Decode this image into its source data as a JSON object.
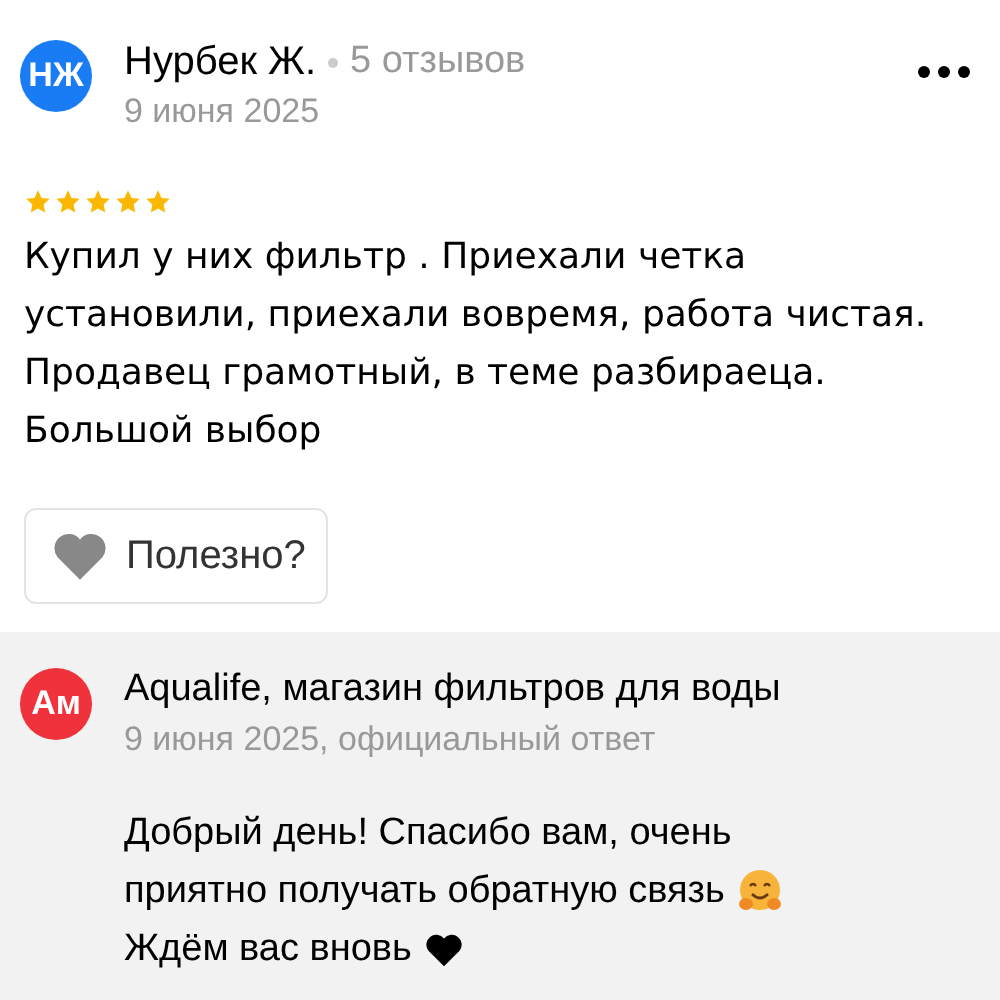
{
  "review": {
    "avatar_initials": "НЖ",
    "author": "Нурбек Ж.",
    "reviews_count": "5 отзывов",
    "date": "9 июня 2025",
    "stars": 5,
    "text": "Купил у них фильтр . Приехали четка установили, приехали вовремя, работа чистая. Продавец грамотный, в теме разбираеца. Большой выбор",
    "helpful_button": "Полезно?"
  },
  "reply": {
    "avatar_initials": "Ам",
    "author": "Aqualife, магазин фильтров для воды",
    "meta": "9 июня 2025, официальный ответ",
    "lines": [
      "Добрый день! Спасибо вам, очень",
      "приятно получать обратную связь",
      "Ждём вас вновь"
    ]
  }
}
